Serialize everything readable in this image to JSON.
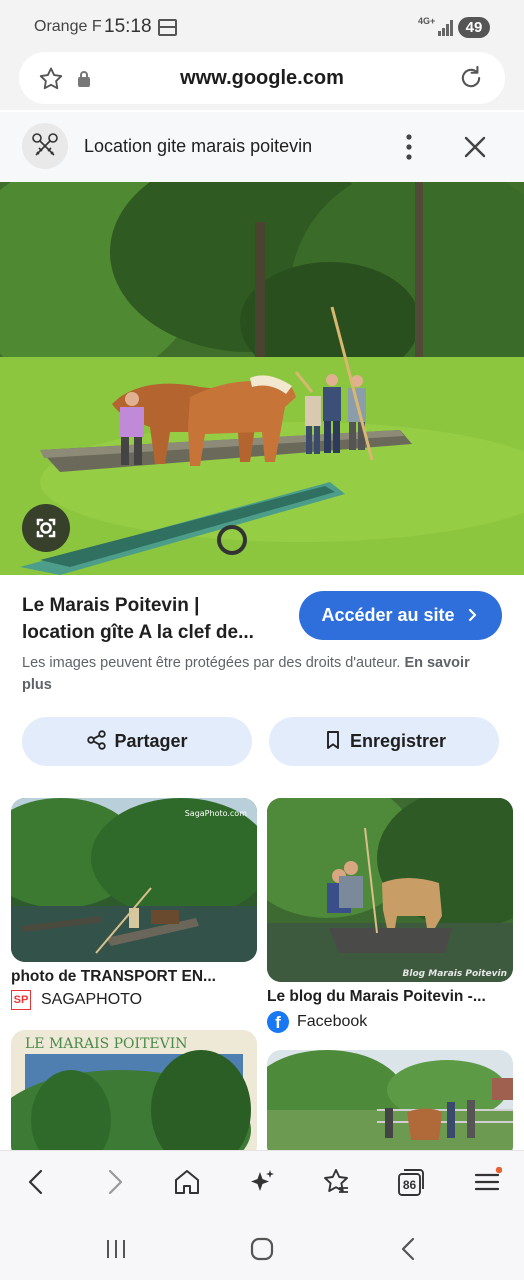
{
  "status_bar": {
    "carrier": "Orange F",
    "time": "15:18",
    "network": "4G+",
    "battery": "49"
  },
  "browser": {
    "url": "www.google.com",
    "tab_count": "86"
  },
  "lens": {
    "title": "Location gite marais poitevin"
  },
  "result": {
    "title_line1": "Le Marais Poitevin |",
    "title_line2": "location gîte A la clef de...",
    "visit_button": "Accéder au site",
    "copyright_text": "Les images peuvent être protégées par des droits d'auteur.",
    "learn_more": "En savoir plus",
    "share_label": "Partager",
    "save_label": "Enregistrer"
  },
  "related": [
    {
      "caption": "photo de TRANSPORT EN...",
      "source": "SAGAPHOTO",
      "source_logo": "SP",
      "watermark": "SagaPhoto.com"
    },
    {
      "caption": "Le blog du Marais Poitevin -...",
      "source": "Facebook",
      "source_logo": "f",
      "watermark": "Blog Marais Poitevin"
    },
    {
      "banner_text": "LE MARAIS POITEVIN"
    },
    {}
  ],
  "colors": {
    "accent": "#2f6fdc",
    "chip_bg": "#e3ecfa",
    "duckweed": "#8cc63f"
  }
}
